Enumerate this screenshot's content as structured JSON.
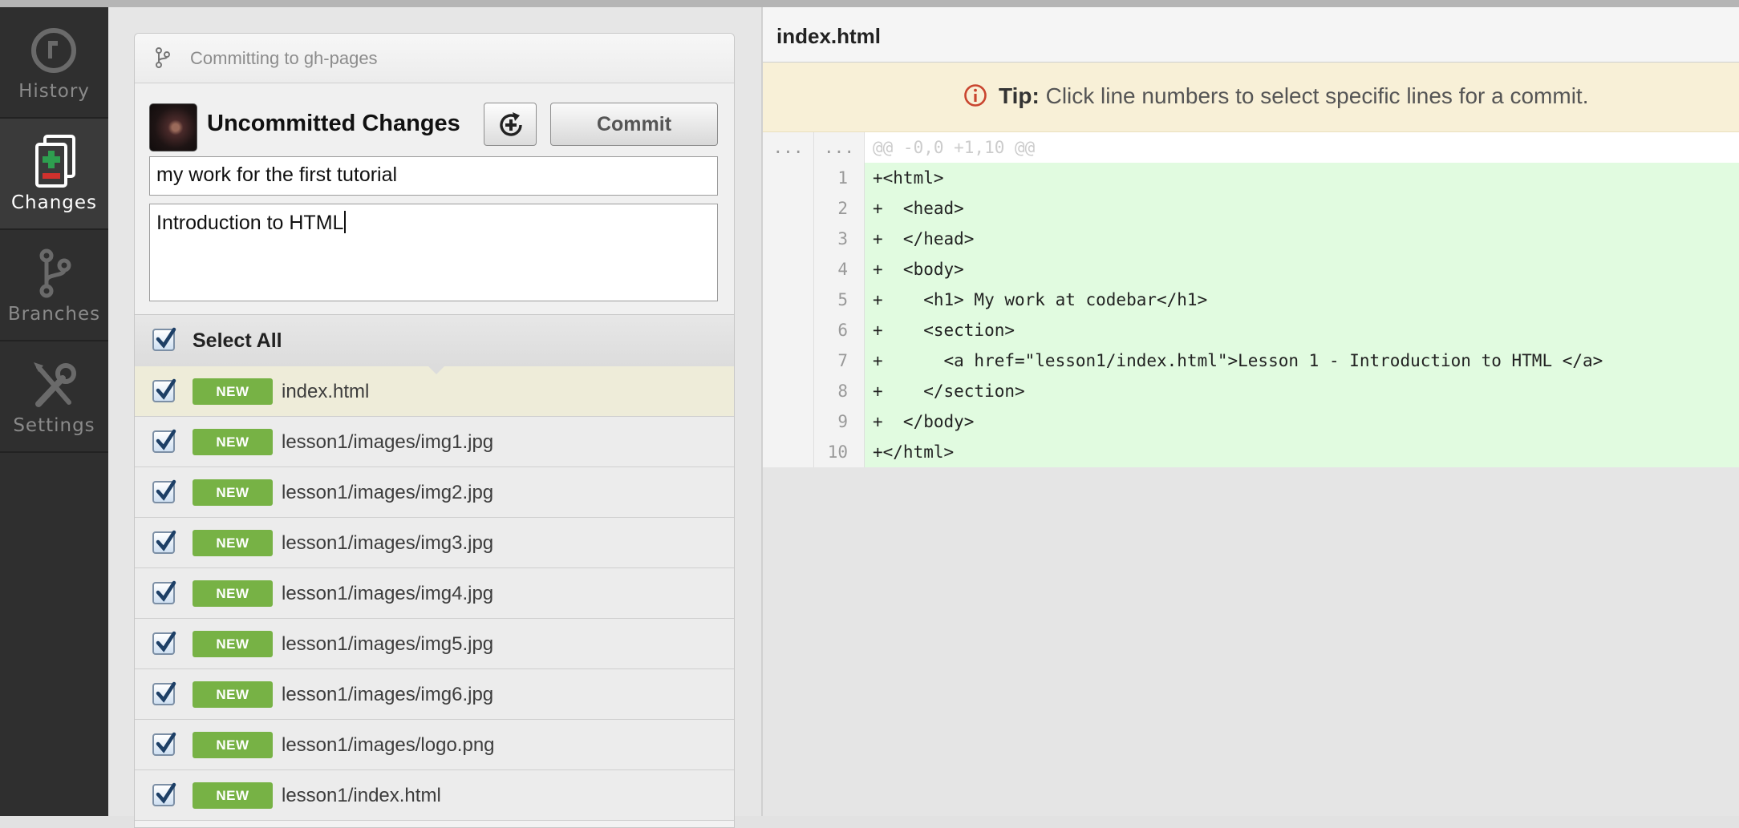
{
  "nav": {
    "items": [
      {
        "label": "History",
        "icon": "history-icon"
      },
      {
        "label": "Changes",
        "icon": "changes-icon"
      },
      {
        "label": "Branches",
        "icon": "branches-icon"
      },
      {
        "label": "Settings",
        "icon": "settings-icon"
      }
    ],
    "active": "Changes"
  },
  "commit_panel": {
    "branch_text": "Committing to gh-pages",
    "title": "Uncommitted Changes",
    "commit_label": "Commit",
    "summary_value": "my work for the first tutorial",
    "description_value": "Introduction to HTML",
    "select_all_label": "Select All"
  },
  "files": [
    {
      "status": "NEW",
      "name": "index.html",
      "selected": true
    },
    {
      "status": "NEW",
      "name": "lesson1/images/img1.jpg"
    },
    {
      "status": "NEW",
      "name": "lesson1/images/img2.jpg"
    },
    {
      "status": "NEW",
      "name": "lesson1/images/img3.jpg"
    },
    {
      "status": "NEW",
      "name": "lesson1/images/img4.jpg"
    },
    {
      "status": "NEW",
      "name": "lesson1/images/img5.jpg"
    },
    {
      "status": "NEW",
      "name": "lesson1/images/img6.jpg"
    },
    {
      "status": "NEW",
      "name": "lesson1/images/logo.png"
    },
    {
      "status": "NEW",
      "name": "lesson1/index.html"
    }
  ],
  "diff": {
    "filename": "index.html",
    "tip_bold": "Tip:",
    "tip_text": " Click line numbers to select specific lines for a commit.",
    "hunk": {
      "old": "...",
      "new": "...",
      "text": "@@ -0,0 +1,10 @@"
    },
    "lines": [
      {
        "num": "1",
        "text": "+<html>"
      },
      {
        "num": "2",
        "text": "+  <head>"
      },
      {
        "num": "3",
        "text": "+  </head>"
      },
      {
        "num": "4",
        "text": "+  <body>"
      },
      {
        "num": "5",
        "text": "+    <h1> My work at codebar</h1>"
      },
      {
        "num": "6",
        "text": "+    <section>"
      },
      {
        "num": "7",
        "text": "+      <a href=\"lesson1/index.html\">Lesson 1 - Introduction to HTML </a>"
      },
      {
        "num": "8",
        "text": "+    </section>"
      },
      {
        "num": "9",
        "text": "+  </body>"
      },
      {
        "num": "10",
        "text": "+</html>"
      }
    ]
  },
  "colors": {
    "nav_bg": "#2f2f2f",
    "new_badge": "#77b245",
    "added_line_bg": "#e1fbe0",
    "tip_bg": "#f8f0d7",
    "checkbox_check": "#1d3f66"
  }
}
